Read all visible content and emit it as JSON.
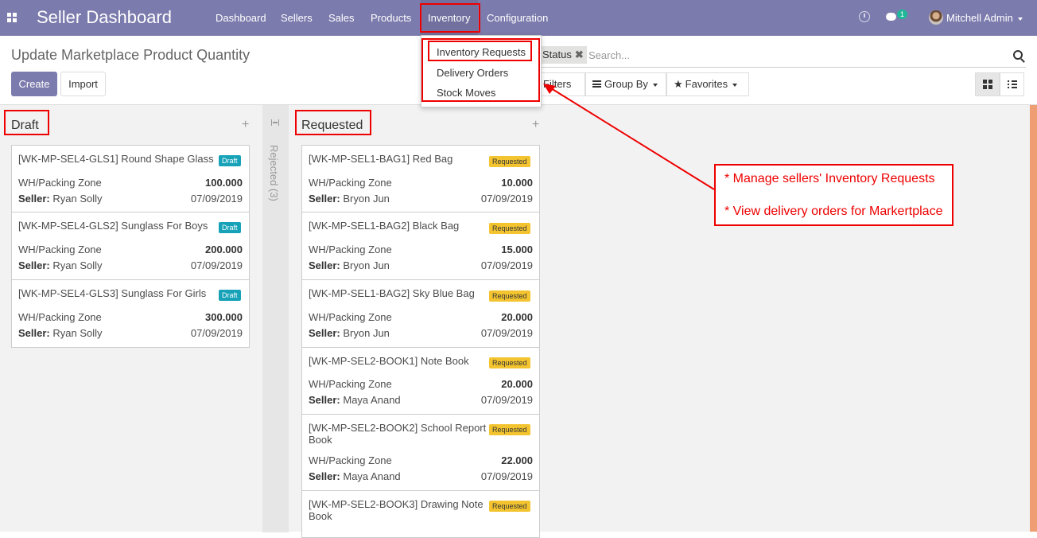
{
  "navbar": {
    "brand": "Seller Dashboard",
    "menu": [
      "Dashboard",
      "Sellers",
      "Sales",
      "Products",
      "Inventory",
      "Configuration"
    ],
    "active_menu": "Inventory",
    "chat_count": "1",
    "user_name": "Mitchell Admin",
    "color": "#7c7bad"
  },
  "inventory_menu": {
    "items": [
      "Inventory Requests",
      "Delivery Orders",
      "Stock Moves"
    ]
  },
  "control_panel": {
    "title": "Update Marketplace Product Quantity",
    "create_label": "Create",
    "import_label": "Import",
    "facet_label": "Status",
    "search_placeholder": "Search...",
    "filters_label": "Filters",
    "groupby_label": "Group By",
    "favorites_label": "Favorites"
  },
  "kanban": {
    "columns": [
      {
        "title": "Draft",
        "cards": [
          {
            "title": "[WK-MP-SEL4-GLS1] Round Shape Glass",
            "badge": "Draft",
            "location": "WH/Packing Zone",
            "qty": "100.000",
            "seller_label": "Seller:",
            "seller": "Ryan Solly",
            "date": "07/09/2019"
          },
          {
            "title": "[WK-MP-SEL4-GLS2] Sunglass For Boys",
            "badge": "Draft",
            "location": "WH/Packing Zone",
            "qty": "200.000",
            "seller_label": "Seller:",
            "seller": "Ryan Solly",
            "date": "07/09/2019"
          },
          {
            "title": "[WK-MP-SEL4-GLS3] Sunglass For Girls",
            "badge": "Draft",
            "location": "WH/Packing Zone",
            "qty": "300.000",
            "seller_label": "Seller:",
            "seller": "Ryan Solly",
            "date": "07/09/2019"
          }
        ]
      },
      {
        "title": "Requested",
        "cards": [
          {
            "title": "[WK-MP-SEL1-BAG1] Red Bag",
            "badge": "Requested",
            "location": "WH/Packing Zone",
            "qty": "10.000",
            "seller_label": "Seller:",
            "seller": "Bryon Jun",
            "date": "07/09/2019"
          },
          {
            "title": "[WK-MP-SEL1-BAG2] Black Bag",
            "badge": "Requested",
            "location": "WH/Packing Zone",
            "qty": "15.000",
            "seller_label": "Seller:",
            "seller": "Bryon Jun",
            "date": "07/09/2019"
          },
          {
            "title": "[WK-MP-SEL1-BAG2] Sky Blue Bag",
            "badge": "Requested",
            "location": "WH/Packing Zone",
            "qty": "20.000",
            "seller_label": "Seller:",
            "seller": "Bryon Jun",
            "date": "07/09/2019"
          },
          {
            "title": "[WK-MP-SEL2-BOOK1] Note Book",
            "badge": "Requested",
            "location": "WH/Packing Zone",
            "qty": "20.000",
            "seller_label": "Seller:",
            "seller": "Maya Anand",
            "date": "07/09/2019"
          },
          {
            "title_line1": "[WK-MP-SEL2-BOOK2] School Report",
            "title_line2": "Book",
            "badge": "Requested",
            "location": "WH/Packing Zone",
            "qty": "22.000",
            "seller_label": "Seller:",
            "seller": "Maya Anand",
            "date": "07/09/2019"
          },
          {
            "title_line1": "[WK-MP-SEL2-BOOK3] Drawing Note",
            "title_line2": "Book",
            "badge": "Requested"
          }
        ]
      }
    ],
    "folded_column": "Rejected (3)"
  },
  "annotation": {
    "line1": "* Manage sellers' Inventory Requests",
    "line2": "* View delivery orders for Markertplace",
    "color": "#e00000"
  }
}
